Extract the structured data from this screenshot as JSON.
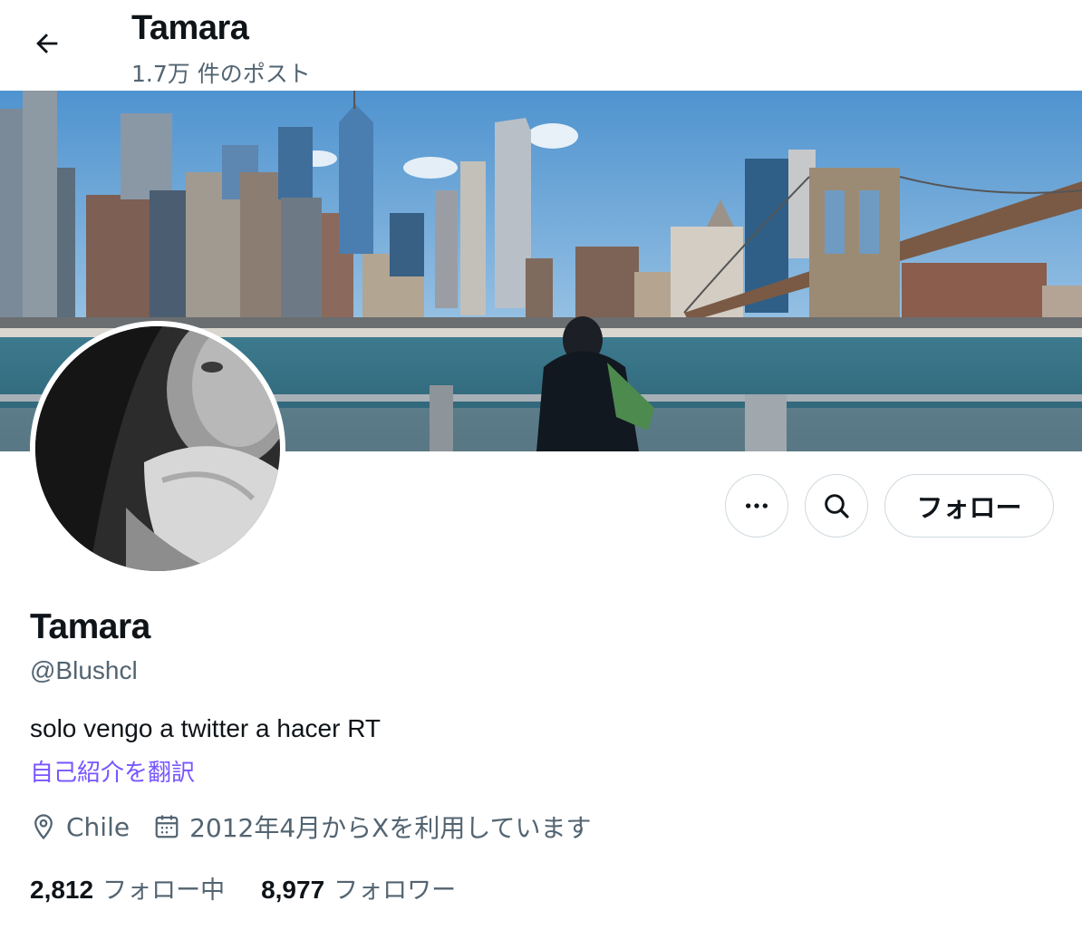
{
  "header": {
    "title": "Tamara",
    "post_count": "1.7万 件のポスト",
    "back_icon": "arrow-left-icon"
  },
  "banner": {
    "description_icon": "banner-photo"
  },
  "actions": {
    "more_icon": "more-horizontal-icon",
    "search_icon": "search-icon",
    "follow_label": "フォロー"
  },
  "profile": {
    "name": "Tamara",
    "handle": "@Blushcl",
    "bio": "solo vengo a twitter a hacer RT",
    "translate_bio": "自己紹介を翻訳",
    "location": "Chile",
    "joined": "2012年4月からXを利用しています",
    "location_icon": "location-pin-icon",
    "calendar_icon": "calendar-icon"
  },
  "stats": {
    "following_count": "2,812",
    "following_label": "フォロー中",
    "followers_count": "8,977",
    "followers_label": "フォロワー"
  },
  "colors": {
    "accent": "#7856ff",
    "text": "#0f1419",
    "muted": "#536471",
    "border": "#cfd9de"
  }
}
